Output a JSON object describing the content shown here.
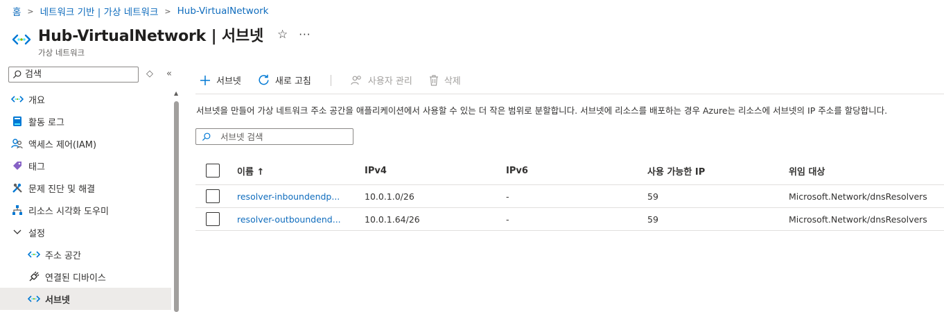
{
  "breadcrumb": [
    "홈",
    "네트워크 기반 | 가상 네트워크",
    "Hub-VirtualNetwork"
  ],
  "header": {
    "title": "Hub-VirtualNetwork | 서브넷",
    "subtitle": "가상 네트워크",
    "star": "☆",
    "more": "···"
  },
  "sidebar": {
    "search_placeholder": "검색",
    "items": [
      {
        "label": "개요",
        "icon": "vnet-icon"
      },
      {
        "label": "활동 로그",
        "icon": "activity-log-icon"
      },
      {
        "label": "액세스 제어(IAM)",
        "icon": "people-icon"
      },
      {
        "label": "태그",
        "icon": "tag-icon"
      },
      {
        "label": "문제 진단 및 해결",
        "icon": "wrench-icon"
      },
      {
        "label": "리소스 시각화 도우미",
        "icon": "hierarchy-icon"
      },
      {
        "label": "설정",
        "icon": "chevron-down-icon"
      },
      {
        "label": "주소 공간",
        "icon": "vnet-icon"
      },
      {
        "label": "연결된 디바이스",
        "icon": "plug-icon"
      },
      {
        "label": "서브넷",
        "icon": "vnet-icon"
      }
    ]
  },
  "toolbar": {
    "add_subnet": "서브넷",
    "refresh": "새로 고침",
    "manage_users": "사용자 관리",
    "delete": "삭제"
  },
  "description": "서브넷을 만들어 가상 네트워크 주소 공간을 애플리케이션에서 사용할 수 있는 더 작은 범위로 분할합니다. 서브넷에 리소스를 배포하는 경우 Azure는 리소스에 서브넷의 IP 주소를 할당합니다.",
  "filter": {
    "placeholder": "서브넷 검색"
  },
  "table": {
    "columns": [
      "이름 ↑",
      "IPv4",
      "IPv6",
      "사용 가능한 IP",
      "위임 대상"
    ],
    "rows": [
      {
        "name": "resolver-inboundendp...",
        "ipv4": "10.0.1.0/26",
        "ipv6": "-",
        "available": "59",
        "delegated": "Microsoft.Network/dnsResolvers"
      },
      {
        "name": "resolver-outboundend...",
        "ipv4": "10.0.1.64/26",
        "ipv6": "-",
        "available": "59",
        "delegated": "Microsoft.Network/dnsResolvers"
      }
    ]
  },
  "colors": {
    "accent": "#0f6cbd",
    "text": "#323130",
    "active_bg": "#edebe9"
  }
}
